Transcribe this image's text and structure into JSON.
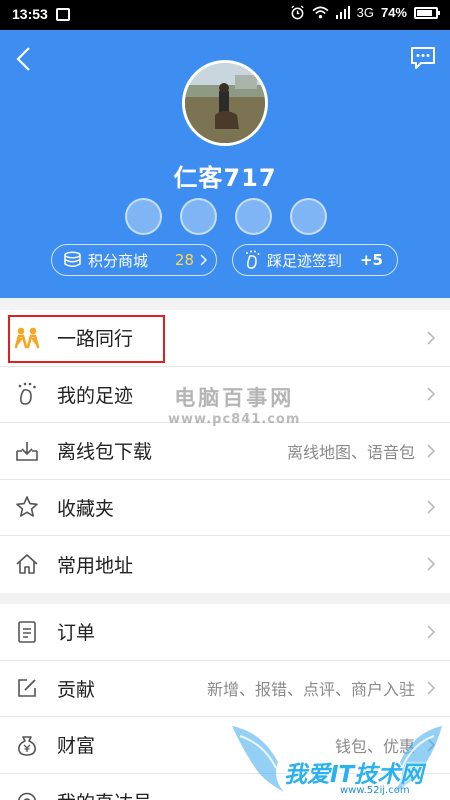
{
  "status_bar": {
    "time": "13:53",
    "network": "3G",
    "battery": "74%",
    "battery_level": 0.74
  },
  "header": {
    "background_color": "#3d8ef0",
    "username": "仁客717",
    "points_pill": {
      "label": "积分商城",
      "value": "28"
    },
    "checkin_pill": {
      "label": "踩足迹签到",
      "value": "+5"
    }
  },
  "menu_section_1": [
    {
      "label": "一路同行",
      "detail": "",
      "icon": "people-icon",
      "highlighted": true
    },
    {
      "label": "我的足迹",
      "detail": "",
      "icon": "footprint-icon"
    },
    {
      "label": "离线包下载",
      "detail": "离线地图、语音包",
      "icon": "download-tray-icon"
    },
    {
      "label": "收藏夹",
      "detail": "",
      "icon": "star-icon"
    },
    {
      "label": "常用地址",
      "detail": "",
      "icon": "home-icon"
    }
  ],
  "menu_section_2": [
    {
      "label": "订单",
      "detail": "",
      "icon": "order-icon"
    },
    {
      "label": "贡献",
      "detail": "新增、报错、点评、商户入驻",
      "icon": "edit-icon"
    },
    {
      "label": "财富",
      "detail": "钱包、优惠",
      "icon": "money-bag-icon"
    },
    {
      "label": "我的直达号",
      "detail": "",
      "icon": "target-icon"
    }
  ],
  "watermarks": {
    "pc841_title": "电脑百事网",
    "pc841_url": "www.pc841.com",
    "bottom_title": "我爱IT技术网",
    "bottom_url": "www.52ij.com"
  },
  "colors": {
    "accent_yellow": "#f5a623",
    "highlight_red": "#e02020"
  }
}
